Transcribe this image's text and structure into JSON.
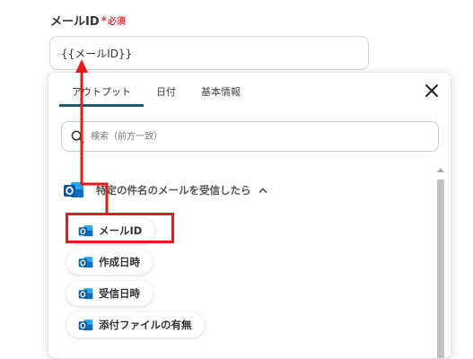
{
  "field": {
    "label": "メールID",
    "required_mark": "*",
    "required_text": "必須",
    "value": "{{メールID}}"
  },
  "dropdown": {
    "tabs": [
      {
        "label": "アウトプット",
        "active": true
      },
      {
        "label": "日付",
        "active": false
      },
      {
        "label": "基本情報",
        "active": false
      }
    ],
    "search_placeholder": "検索（前方一致）",
    "group": {
      "title": "特定の件名のメールを受信したら",
      "icon": "outlook-icon",
      "expanded": true
    },
    "items": [
      {
        "label": "メールID",
        "icon": "outlook-icon",
        "highlighted": true
      },
      {
        "label": "作成日時",
        "icon": "outlook-icon"
      },
      {
        "label": "受信日時",
        "icon": "outlook-icon"
      },
      {
        "label": "添付ファイルの有無",
        "icon": "outlook-icon"
      }
    ]
  },
  "colors": {
    "accent": "#1f5b6e",
    "required": "#e23a3a",
    "annotation": "#e8191b",
    "outlook_blue": "#0f6cbd"
  }
}
